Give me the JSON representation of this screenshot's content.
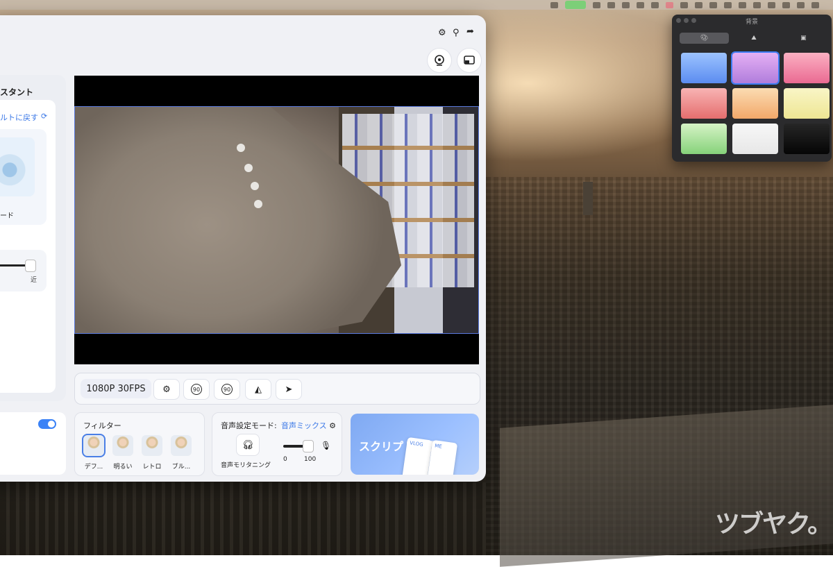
{
  "app": {
    "side_title": "スタント",
    "reset_label": "ルトに戻す",
    "mode_label": "ード",
    "slider_near_label": "近",
    "resolution": "1080P 30FPS",
    "rotate_left_label": "90",
    "rotate_right_label": "90",
    "filter": {
      "title": "フィルター",
      "items": [
        {
          "label": "デフ...",
          "selected": true
        },
        {
          "label": "明るい",
          "selected": false
        },
        {
          "label": "レトロ",
          "selected": false
        },
        {
          "label": "ブル...",
          "selected": false
        }
      ]
    },
    "audio": {
      "title": "音声設定モード:",
      "mode": "音声ミックス",
      "monitor_label": "音声モリタニング",
      "volume_min": "0",
      "volume_max": "100",
      "volume_level": 0.85
    },
    "script": {
      "title": "スクリプト作成",
      "phone_labels": [
        "VLOG",
        "ME"
      ]
    }
  },
  "palette": {
    "title": "背景",
    "tabs": [
      "palette-icon",
      "mountain-icon",
      "image-icon"
    ],
    "active_tab": 0,
    "swatches": [
      {
        "from": "#9cc3ff",
        "to": "#5b8cf0",
        "selected": false
      },
      {
        "from": "#e5b0f4",
        "to": "#b07ddc",
        "selected": true
      },
      {
        "from": "#fbb0c2",
        "to": "#ea6a92",
        "selected": false
      },
      {
        "from": "#f8b4b4",
        "to": "#e56e6e",
        "selected": false
      },
      {
        "from": "#fbdcb2",
        "to": "#f2a86a",
        "selected": false
      },
      {
        "from": "#f9f5c6",
        "to": "#eee694",
        "selected": false
      },
      {
        "from": "#d6f3c6",
        "to": "#86d27a",
        "selected": false
      },
      {
        "from": "#f7f7f7",
        "to": "#e7e7e7",
        "selected": false
      },
      {
        "from": "#262626",
        "to": "#050505",
        "selected": false
      }
    ]
  },
  "watermark": "ツブヤク。",
  "colors": {
    "accent": "#3b78e7",
    "toggle_on": "#3b82f6"
  }
}
